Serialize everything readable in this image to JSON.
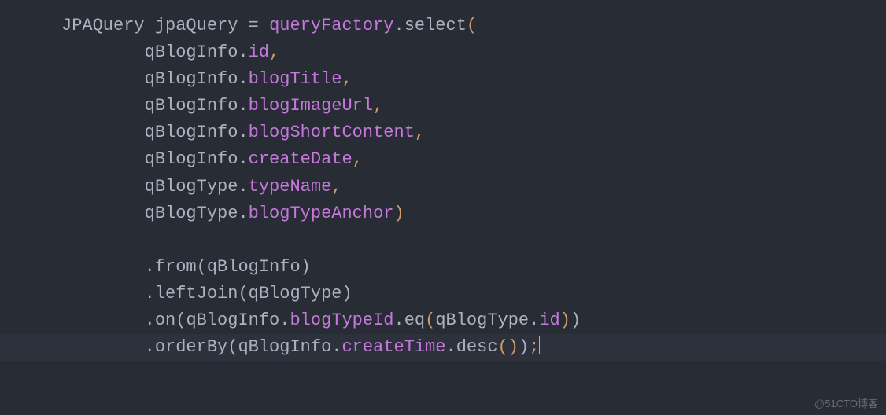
{
  "code": {
    "line1": {
      "type": "JPAQuery",
      "var": "jpaQuery",
      "eq": " = ",
      "factory": "queryFactory",
      "dot": ".",
      "select": "select",
      "open": "("
    },
    "line2": {
      "indent": "        ",
      "obj": "qBlogInfo",
      "dot": ".",
      "prop": "id",
      "comma": ","
    },
    "line3": {
      "indent": "        ",
      "obj": "qBlogInfo",
      "dot": ".",
      "prop": "blogTitle",
      "comma": ","
    },
    "line4": {
      "indent": "        ",
      "obj": "qBlogInfo",
      "dot": ".",
      "prop": "blogImageUrl",
      "comma": ","
    },
    "line5": {
      "indent": "        ",
      "obj": "qBlogInfo",
      "dot": ".",
      "prop": "blogShortContent",
      "comma": ","
    },
    "line6": {
      "indent": "        ",
      "obj": "qBlogInfo",
      "dot": ".",
      "prop": "createDate",
      "comma": ","
    },
    "line7": {
      "indent": "        ",
      "obj": "qBlogType",
      "dot": ".",
      "prop": "typeName",
      "comma": ","
    },
    "line8": {
      "indent": "        ",
      "obj": "qBlogType",
      "dot": ".",
      "prop": "blogTypeAnchor",
      "close": ")"
    },
    "line9": {
      "blank": ""
    },
    "line10": {
      "indent": "        ",
      "dot": ".",
      "method": "from",
      "open": "(",
      "arg": "qBlogInfo",
      "close": ")"
    },
    "line11": {
      "indent": "        ",
      "dot": ".",
      "method": "leftJoin",
      "open": "(",
      "arg": "qBlogType",
      "close": ")"
    },
    "line12": {
      "indent": "        ",
      "dot": ".",
      "method": "on",
      "open": "(",
      "obj1": "qBlogInfo",
      "dot1": ".",
      "prop1": "blogTypeId",
      "dot2": ".",
      "eq": "eq",
      "open2": "(",
      "obj2": "qBlogType",
      "dot3": ".",
      "prop2": "id",
      "close2": ")",
      "close": ")"
    },
    "line13": {
      "indent": "        ",
      "dot": ".",
      "method": "orderBy",
      "open": "(",
      "obj": "qBlogInfo",
      "dot1": ".",
      "prop": "createTime",
      "dot2": ".",
      "desc": "desc",
      "open2": "(",
      "close2": ")",
      "close": ")",
      "semi": ";"
    }
  },
  "watermark": "@51CTO博客"
}
